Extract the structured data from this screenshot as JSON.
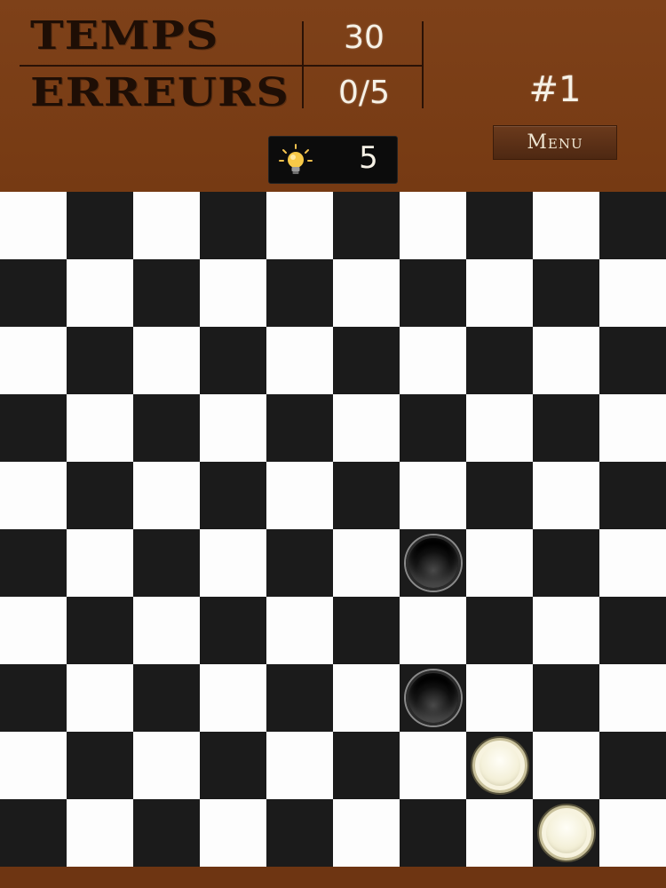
{
  "header": {
    "time_label": "TEMPS",
    "errors_label": "ERREURS",
    "time_value": "30",
    "errors_value": "0/5",
    "level": "#1",
    "menu_label": "Menu",
    "hints_icon": "lightbulb-icon",
    "hints_count": "5"
  },
  "colors": {
    "wood": "#7a3d15",
    "dark_square": "#1b1b1b",
    "light_square": "#fdfdfd",
    "chalk": "#f6f1e6"
  },
  "board": {
    "columns": 10,
    "rows": 10,
    "top_left_color": "light",
    "pieces": [
      {
        "color": "black",
        "row": 5,
        "col": 6
      },
      {
        "color": "black",
        "row": 7,
        "col": 6
      },
      {
        "color": "white",
        "row": 8,
        "col": 7
      },
      {
        "color": "white",
        "row": 9,
        "col": 8
      }
    ]
  }
}
